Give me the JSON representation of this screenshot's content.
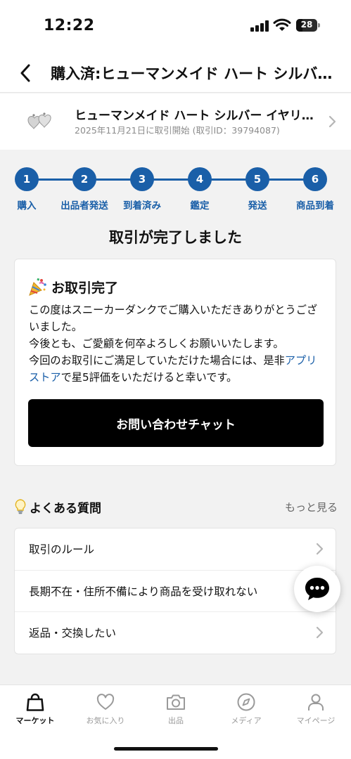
{
  "status_bar": {
    "time": "12:22",
    "battery": "28"
  },
  "header": {
    "title": "購入済:ヒューマンメイド ハート シルバー イヤリング"
  },
  "product": {
    "name": "ヒューマンメイド ハート シルバー イヤリング",
    "meta": "2025年11月21日に取引開始 (取引ID：39794087)"
  },
  "steps": [
    {
      "number": "1",
      "label": "購入"
    },
    {
      "number": "2",
      "label": "出品者発送"
    },
    {
      "number": "3",
      "label": "到着済み"
    },
    {
      "number": "4",
      "label": "鑑定"
    },
    {
      "number": "5",
      "label": "発送"
    },
    {
      "number": "6",
      "label": "商品到着"
    }
  ],
  "colors": {
    "accent": "#1a5fa8",
    "button": "#000000"
  },
  "completion": {
    "heading": "取引が完了しました",
    "card_title": "お取引完了",
    "body_line1": "この度はスニーカーダンクでご購入いただきありがとうございました。",
    "body_line2": "今後とも、ご愛顧を何卒よろしくお願いいたします。",
    "body_line3_prefix": "今回のお取引にご満足していただけた場合には、是非",
    "body_link": "アプリストア",
    "body_line3_suffix": "で星5評価をいただけると幸いです。",
    "chat_button": "お問い合わせチャット"
  },
  "faq": {
    "title": "よくある質問",
    "more": "もっと見る",
    "items": [
      {
        "label": "取引のルール"
      },
      {
        "label": "長期不在・住所不備により商品を受け取れない"
      },
      {
        "label": "返品・交換したい"
      }
    ]
  },
  "tabs": [
    {
      "label": "マーケット",
      "icon": "bag-icon"
    },
    {
      "label": "お気に入り",
      "icon": "heart-icon"
    },
    {
      "label": "出品",
      "icon": "camera-icon"
    },
    {
      "label": "メディア",
      "icon": "compass-icon"
    },
    {
      "label": "マイページ",
      "icon": "person-icon"
    }
  ]
}
